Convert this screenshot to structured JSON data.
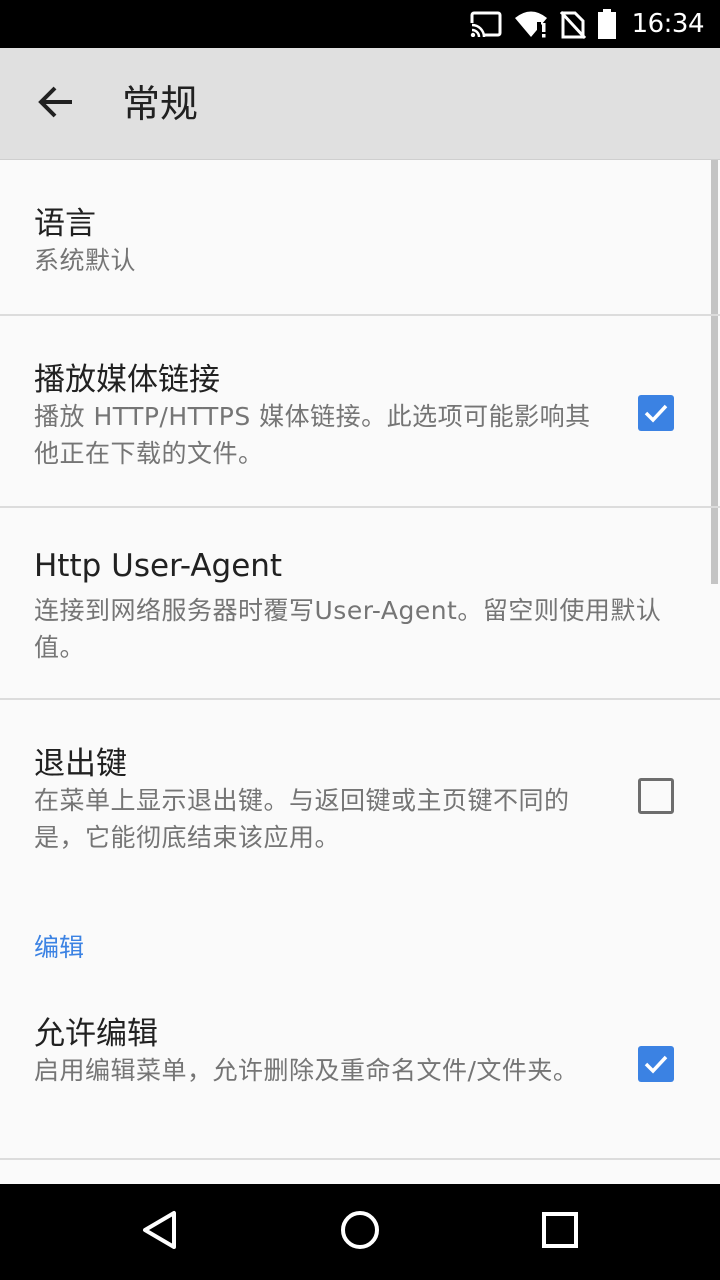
{
  "status_bar": {
    "time": "16:34",
    "icons": [
      "cast-icon",
      "wifi-icon",
      "no-sim-icon",
      "battery-icon"
    ]
  },
  "app_bar": {
    "back_icon": "arrow-back-icon",
    "title": "常规"
  },
  "preferences": [
    {
      "title": "语言",
      "summary": "系统默认",
      "has_checkbox": false
    },
    {
      "title": "播放媒体链接",
      "summary": "播放 HTTP/HTTPS 媒体链接。此选项可能影响其他正在下载的文件。",
      "has_checkbox": true,
      "checked": true
    },
    {
      "title": "Http User-Agent",
      "summary": "连接到网络服务器时覆写User-Agent。留空则使用默认值。",
      "has_checkbox": false
    },
    {
      "title": "退出键",
      "summary": "在菜单上显示退出键。与返回键或主页键不同的是，它能彻底结束该应用。",
      "has_checkbox": true,
      "checked": false
    }
  ],
  "category": {
    "title": "编辑",
    "items": [
      {
        "title": "允许编辑",
        "summary": "启用编辑菜单，允许删除及重命名文件/文件夹。",
        "has_checkbox": true,
        "checked": true
      }
    ]
  },
  "colors": {
    "accent": "#3b82e3",
    "app_bar": "#e0e0e0",
    "background": "#fafafa",
    "status_bar": "#000000"
  },
  "nav_bar": {
    "icons": [
      "back-triangle-icon",
      "home-circle-icon",
      "recents-square-icon"
    ]
  }
}
